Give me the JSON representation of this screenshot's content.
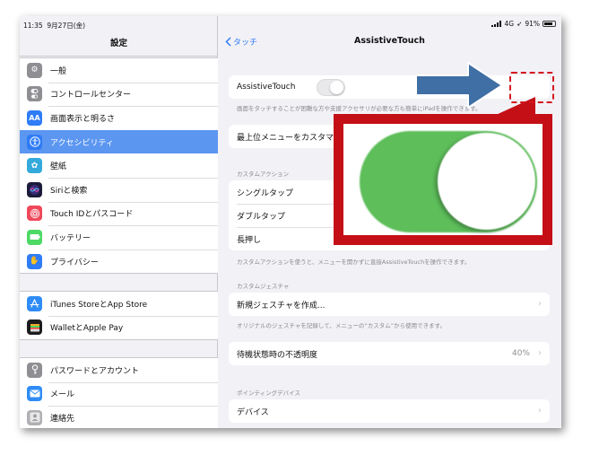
{
  "status": {
    "time": "11:35",
    "date": "9月27日(金)",
    "network": "4G",
    "battery": "91%"
  },
  "sidebar": {
    "title": "設定",
    "groups": [
      {
        "items": [
          {
            "label": "一般",
            "icon": "gear-icon",
            "color": "#8e8e93"
          },
          {
            "label": "コントロールセンター",
            "icon": "switches-icon",
            "color": "#8e8e93"
          },
          {
            "label": "画面表示と明るさ",
            "icon": "text-size-icon",
            "color": "#2f7cf6"
          },
          {
            "label": "アクセシビリティ",
            "icon": "accessibility-icon",
            "color": "#2f7cf6",
            "selected": true
          },
          {
            "label": "壁紙",
            "icon": "wallpaper-icon",
            "color": "#34aadc"
          },
          {
            "label": "Siriと検索",
            "icon": "siri-icon",
            "color": "#1c1c3a"
          },
          {
            "label": "Touch IDとパスコード",
            "icon": "fingerprint-icon",
            "color": "#f0485a"
          },
          {
            "label": "バッテリー",
            "icon": "battery-icon",
            "color": "#4cd964"
          },
          {
            "label": "プライバシー",
            "icon": "hand-icon",
            "color": "#2f7cf6"
          }
        ]
      },
      {
        "items": [
          {
            "label": "iTunes StoreとApp Store",
            "icon": "app-store-icon",
            "color": "#2f8cf6"
          },
          {
            "label": "WalletとApple Pay",
            "icon": "wallet-icon",
            "color": "#1c1c1e"
          }
        ]
      },
      {
        "items": [
          {
            "label": "パスワードとアカウント",
            "icon": "key-icon",
            "color": "#8e8e93"
          },
          {
            "label": "メール",
            "icon": "mail-icon",
            "color": "#2f8cf6"
          },
          {
            "label": "連絡先",
            "icon": "contacts-icon",
            "color": "#b0b0b4"
          }
        ]
      }
    ]
  },
  "main": {
    "back_label": "タッチ",
    "title": "AssistiveTouch",
    "assistive_label": "AssistiveTouch",
    "assistive_enabled": false,
    "assistive_note": "画面をタッチすることが困難な方や支援アクセサリが必要な方も簡単にiPadを操作できます。",
    "top_menu_label": "最上位メニューをカスタマイズ...",
    "custom_actions_header": "カスタムアクション",
    "custom_actions": [
      {
        "label": "シングルタップ"
      },
      {
        "label": "ダブルタップ"
      },
      {
        "label": "長押し"
      }
    ],
    "custom_actions_note": "カスタムアクションを使うと、メニューを開かずに直接AssistiveTouchを操作できます。",
    "custom_gestures_header": "カスタムジェスチャ",
    "new_gesture_label": "新規ジェスチャを作成...",
    "new_gesture_note": "オリジナルのジェスチャを記録して、メニューの“カスタム”から使用できます。",
    "idle_opacity_label": "待機状態時の不透明度",
    "idle_opacity_value": "40%",
    "pointing_header": "ポインティングデバイス",
    "devices_label": "デバイス"
  },
  "annotation": {
    "zoom_toggle_on": true,
    "arrow_color": "#3f6fa4",
    "highlight_color": "#d4141e"
  }
}
